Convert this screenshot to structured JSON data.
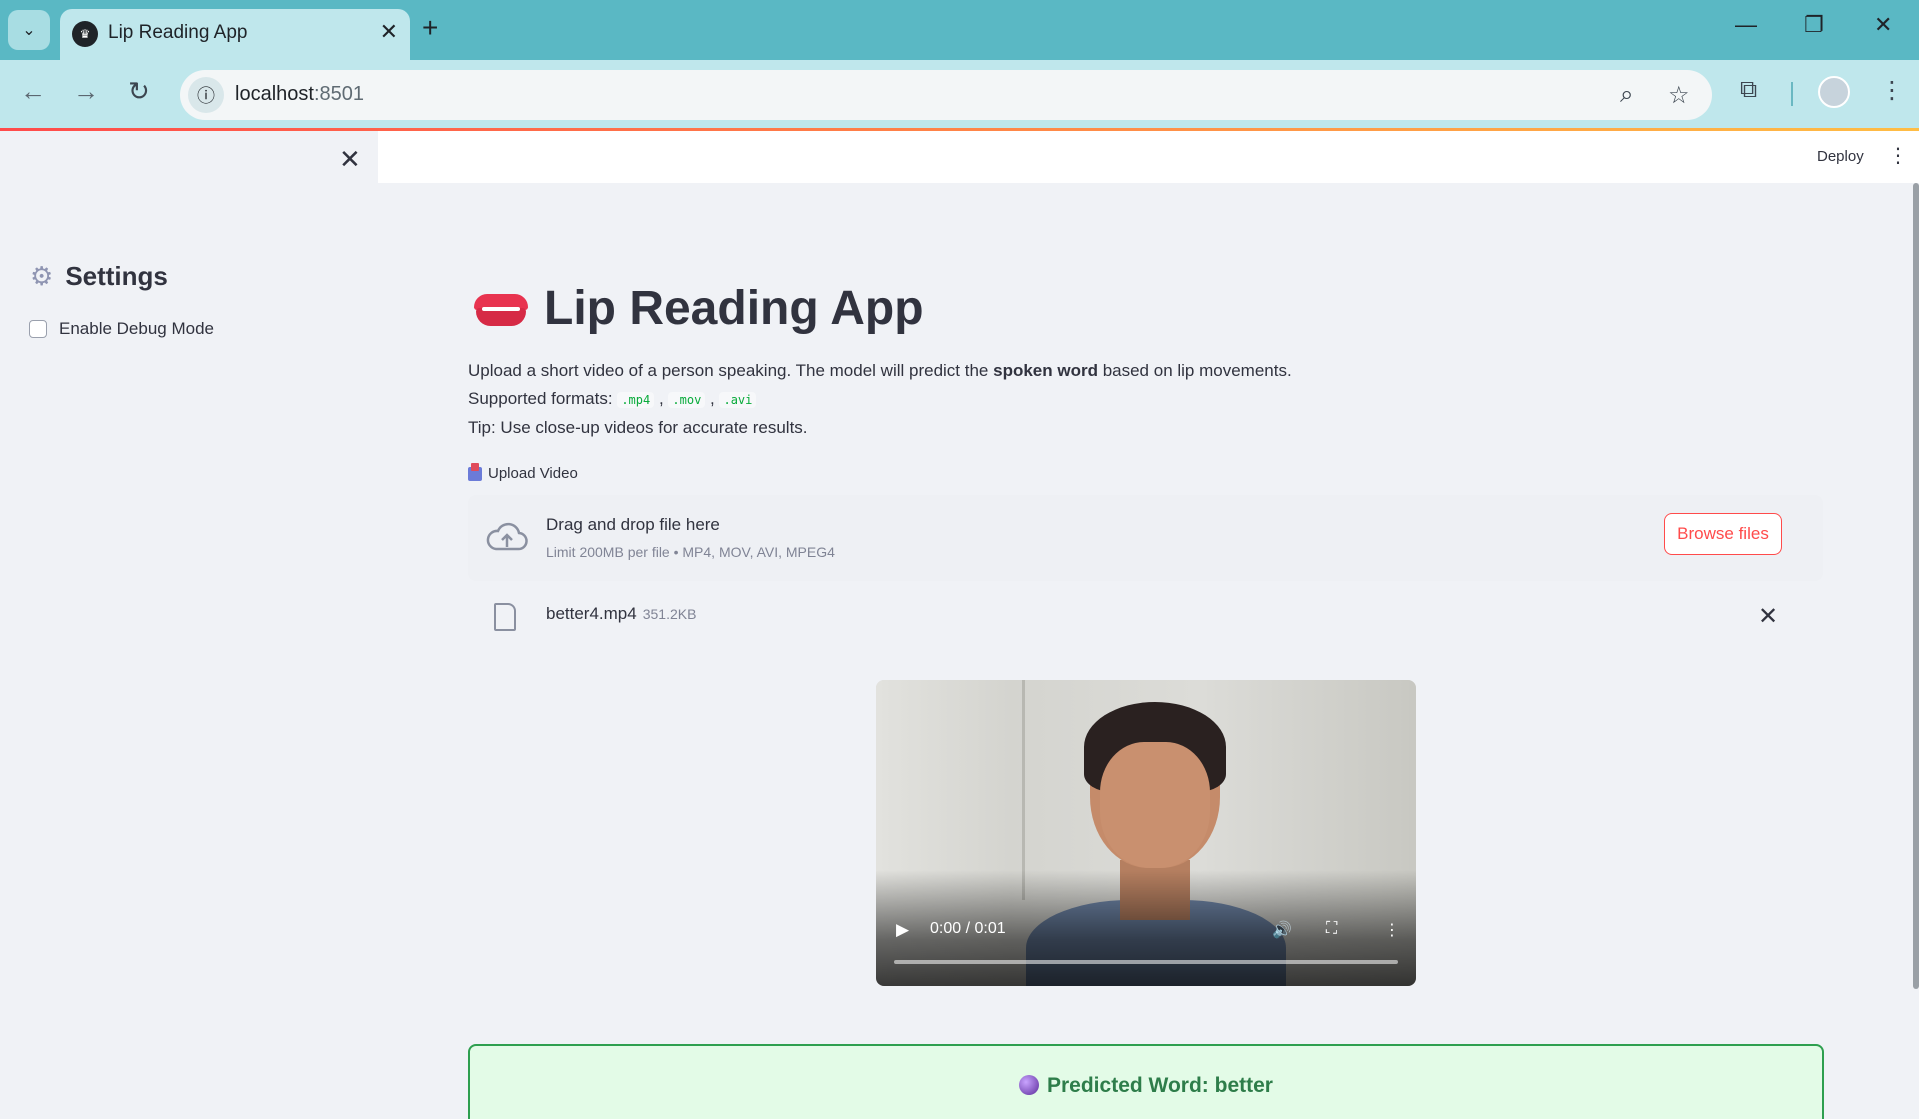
{
  "browser": {
    "tab_title": "Lip Reading App",
    "url_host": "localhost",
    "url_port": ":8501"
  },
  "app": {
    "deploy_label": "Deploy",
    "title": "Lip Reading App",
    "description_before": "Upload a short video of a person speaking. The model will predict the ",
    "description_bold": "spoken word",
    "description_after": " based on lip movements.",
    "formats_label": "Supported formats:",
    "formats": [
      ".mp4",
      ".mov",
      ".avi"
    ],
    "tip": "Tip: Use close-up videos for accurate results."
  },
  "sidebar": {
    "title": "Settings",
    "debug_label": "Enable Debug Mode",
    "debug_checked": false
  },
  "uploader": {
    "label": "Upload Video",
    "dropzone_title": "Drag and drop file here",
    "dropzone_limits": "Limit 200MB per file • MP4, MOV, AVI, MPEG4",
    "browse_label": "Browse files",
    "file_name": "better4.mp4",
    "file_size": "351.2KB"
  },
  "video": {
    "time": "0:00 / 0:01",
    "progress": 0
  },
  "prediction": {
    "text": "Predicted Word: better"
  },
  "colors": {
    "accent": "#ff4b4b",
    "success_border": "#2e9f4f",
    "success_bg": "#e3fbe7"
  }
}
